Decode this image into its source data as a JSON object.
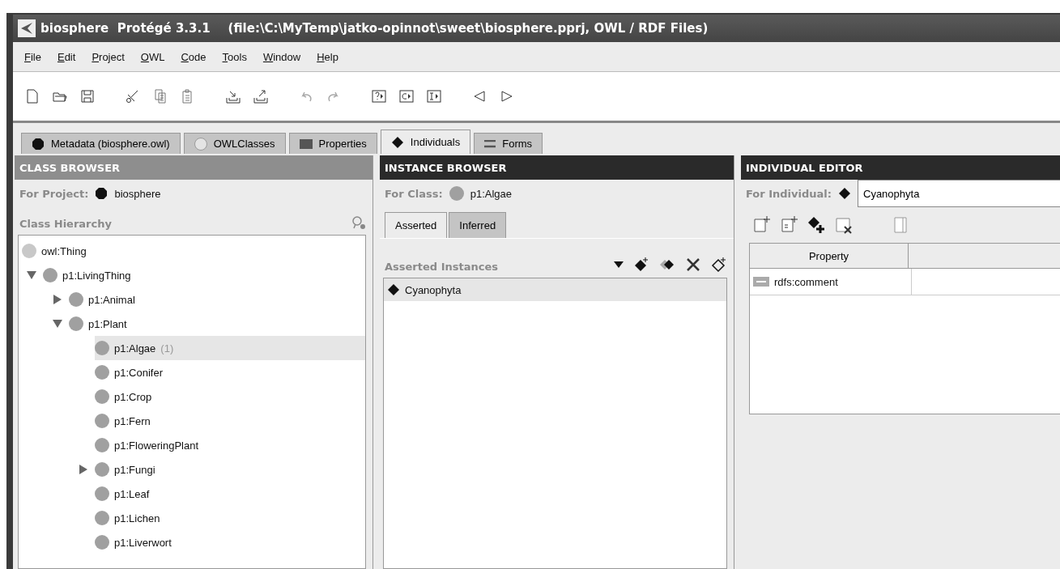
{
  "window": {
    "title": "biosphere  Protégé 3.3.1",
    "file": "(file:\\C:\\MyTemp\\jatko-opinnot\\sweet\\biosphere.pprj, OWL / RDF Files)"
  },
  "menu": [
    "File",
    "Edit",
    "Project",
    "OWL",
    "Code",
    "Tools",
    "Window",
    "Help"
  ],
  "tabs": [
    {
      "label": "Metadata (biosphere.owl)",
      "selected": false
    },
    {
      "label": "OWLClasses",
      "selected": false
    },
    {
      "label": "Properties",
      "selected": false
    },
    {
      "label": "Individuals",
      "selected": true
    },
    {
      "label": "Forms",
      "selected": false
    }
  ],
  "class_browser": {
    "header": "CLASS BROWSER",
    "project_label": "For Project:",
    "project": "biosphere",
    "hierarchy_label": "Class Hierarchy",
    "tree": [
      {
        "label": "owl:Thing",
        "color": "#c8c8c8",
        "selected": false,
        "children": [
          {
            "label": "p1:LivingThing",
            "color": "#a0a0a0",
            "selected": false,
            "expanded": true,
            "children": [
              {
                "label": "p1:Animal",
                "color": "#a0a0a0",
                "selected": false,
                "expanded": false
              },
              {
                "label": "p1:Plant",
                "color": "#a0a0a0",
                "selected": false,
                "expanded": true,
                "children": [
                  {
                    "label": "p1:Algae",
                    "count": "(1)",
                    "color": "#a0a0a0",
                    "selected": true
                  },
                  {
                    "label": "p1:Conifer",
                    "color": "#a0a0a0",
                    "selected": false
                  },
                  {
                    "label": "p1:Crop",
                    "color": "#a0a0a0",
                    "selected": false
                  },
                  {
                    "label": "p1:Fern",
                    "color": "#a0a0a0",
                    "selected": false
                  },
                  {
                    "label": "p1:FloweringPlant",
                    "color": "#a0a0a0",
                    "selected": false
                  },
                  {
                    "label": "p1:Fungi",
                    "color": "#a0a0a0",
                    "selected": false,
                    "expanded": false
                  },
                  {
                    "label": "p1:Leaf",
                    "color": "#a0a0a0",
                    "selected": false
                  },
                  {
                    "label": "p1:Lichen",
                    "color": "#a0a0a0",
                    "selected": false
                  },
                  {
                    "label": "p1:Liverwort",
                    "color": "#a0a0a0",
                    "selected": false
                  }
                ]
              }
            ]
          }
        ]
      }
    ]
  },
  "instance_browser": {
    "header": "INSTANCE BROWSER",
    "class_label": "For Class:",
    "class": "p1:Algae",
    "subtabs": [
      {
        "label": "Asserted",
        "selected": true
      },
      {
        "label": "Inferred",
        "selected": false
      }
    ],
    "list_label": "Asserted Instances",
    "instances": [
      {
        "label": "Cyanophyta",
        "selected": true
      }
    ]
  },
  "individual_editor": {
    "header": "INDIVIDUAL EDITOR",
    "individual_label": "For Individual:",
    "individual": "Cyanophyta",
    "columns": [
      "Property"
    ],
    "rows": [
      {
        "property": "rdfs:comment"
      }
    ]
  }
}
